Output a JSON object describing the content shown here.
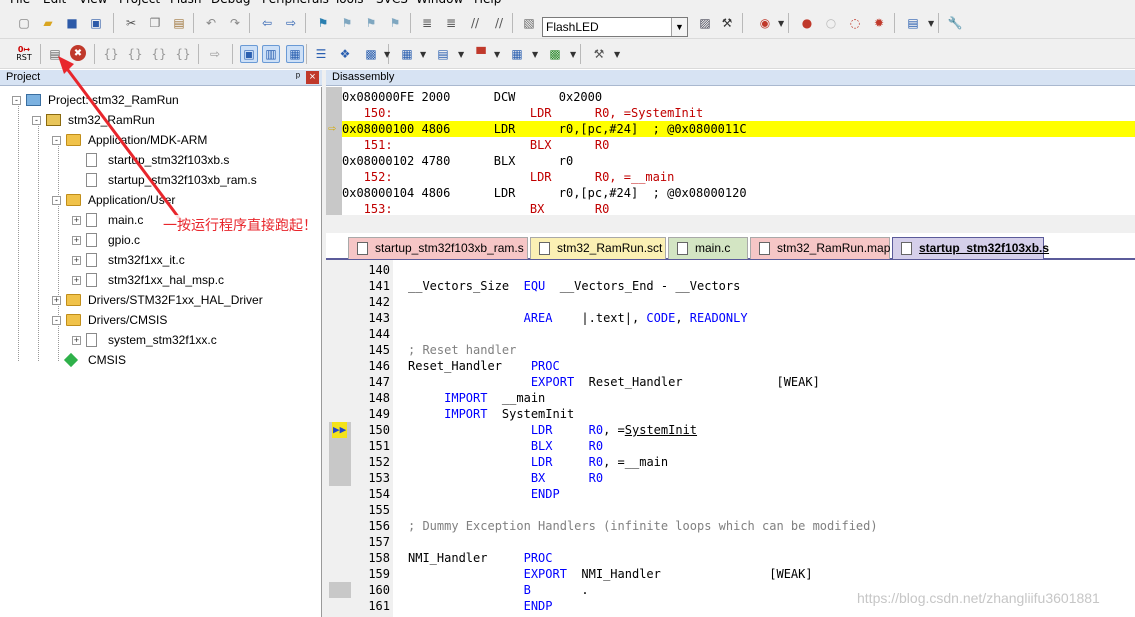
{
  "menu": [
    "File",
    "Edit",
    "View",
    "Project",
    "Flash",
    "Debug",
    "Peripherals",
    "Tools",
    "SVCS",
    "Window",
    "Help"
  ],
  "toolbar": {
    "target_combo": "FlashLED",
    "rst_label": "RST"
  },
  "project_panel": {
    "title": "Project",
    "pin": "ᵖ",
    "close": "×"
  },
  "tree": [
    {
      "label": "Project: stm32_RamRun",
      "level": 0,
      "type": "project",
      "expander": "-"
    },
    {
      "label": "stm32_RamRun",
      "level": 1,
      "type": "target",
      "expander": "-"
    },
    {
      "label": "Application/MDK-ARM",
      "level": 2,
      "type": "folder",
      "expander": "-"
    },
    {
      "label": "startup_stm32f103xb.s",
      "level": 3,
      "type": "file",
      "expander": ""
    },
    {
      "label": "startup_stm32f103xb_ram.s",
      "level": 3,
      "type": "file",
      "expander": ""
    },
    {
      "label": "Application/User",
      "level": 2,
      "type": "folder",
      "expander": "-"
    },
    {
      "label": "main.c",
      "level": 3,
      "type": "file",
      "expander": "+"
    },
    {
      "label": "gpio.c",
      "level": 3,
      "type": "file",
      "expander": "+"
    },
    {
      "label": "stm32f1xx_it.c",
      "level": 3,
      "type": "file",
      "expander": "+"
    },
    {
      "label": "stm32f1xx_hal_msp.c",
      "level": 3,
      "type": "file",
      "expander": "+"
    },
    {
      "label": "Drivers/STM32F1xx_HAL_Driver",
      "level": 2,
      "type": "folder",
      "expander": "+"
    },
    {
      "label": "Drivers/CMSIS",
      "level": 2,
      "type": "folder",
      "expander": "-"
    },
    {
      "label": "system_stm32f1xx.c",
      "level": 3,
      "type": "file",
      "expander": "+"
    },
    {
      "label": "CMSIS",
      "level": 2,
      "type": "component",
      "expander": ""
    }
  ],
  "disassembly": {
    "title": "Disassembly",
    "lines": [
      {
        "text": "0x080000FE 2000      DCW      0x2000",
        "kind": "asm"
      },
      {
        "text": "   150:                   LDR      R0, =SystemInit",
        "kind": "src"
      },
      {
        "text": "0x08000100 4806      LDR      r0,[pc,#24]  ; @0x0800011C",
        "kind": "hl"
      },
      {
        "text": "   151:                   BLX      R0",
        "kind": "src"
      },
      {
        "text": "0x08000102 4780      BLX      r0",
        "kind": "asm"
      },
      {
        "text": "   152:                   LDR      R0, =__main",
        "kind": "src"
      },
      {
        "text": "0x08000104 4806      LDR      r0,[pc,#24]  ; @0x08000120",
        "kind": "asm"
      },
      {
        "text": "   153:                   BX       R0",
        "kind": "src"
      }
    ]
  },
  "tabs": [
    {
      "label": "startup_stm32f103xb_ram.s",
      "color": "#f6c6c6",
      "active": false
    },
    {
      "label": "stm32_RamRun.sct",
      "color": "#fbf0b4",
      "active": false
    },
    {
      "label": "main.c",
      "color": "#d3e5c3",
      "active": false
    },
    {
      "label": "stm32_RamRun.map",
      "color": "#f6c6c6",
      "active": false
    },
    {
      "label": "startup_stm32f103xb.s",
      "color": "#d5cfea",
      "active": true
    }
  ],
  "editor": [
    {
      "n": "140",
      "html": ""
    },
    {
      "n": "141",
      "html": "__Vectors_Size  <span class='kw'>EQU</span>  __Vectors_End - __Vectors"
    },
    {
      "n": "142",
      "html": ""
    },
    {
      "n": "143",
      "html": "                <span class='kw'>AREA</span>    |.text|, <span class='kw'>CODE</span>, <span class='kw'>READONLY</span>"
    },
    {
      "n": "144",
      "html": ""
    },
    {
      "n": "145",
      "html": "<span class='cm'>; Reset handler</span>"
    },
    {
      "n": "146",
      "html": "Reset_Handler    <span class='kw'>PROC</span>"
    },
    {
      "n": "147",
      "html": "                 <span class='kw'>EXPORT</span>  Reset_Handler             [WEAK]"
    },
    {
      "n": "148",
      "html": "     <span class='kw'>IMPORT</span>  __main"
    },
    {
      "n": "149",
      "html": "     <span class='kw'>IMPORT</span>  SystemInit"
    },
    {
      "n": "150",
      "html": "                 <span class='kw'>LDR</span>     <span class='kw'>R0</span>, =<u>SystemInit</u>"
    },
    {
      "n": "151",
      "html": "                 <span class='kw'>BLX</span>     <span class='kw'>R0</span>"
    },
    {
      "n": "152",
      "html": "                 <span class='kw'>LDR</span>     <span class='kw'>R0</span>, =__main"
    },
    {
      "n": "153",
      "html": "                 <span class='kw'>BX</span>      <span class='kw'>R0</span>"
    },
    {
      "n": "154",
      "html": "                 <span class='kw'>ENDP</span>"
    },
    {
      "n": "155",
      "html": ""
    },
    {
      "n": "156",
      "html": "<span class='cm'>; Dummy Exception Handlers (infinite loops which can be modified)</span>"
    },
    {
      "n": "157",
      "html": ""
    },
    {
      "n": "158",
      "html": "NMI_Handler     <span class='kw'>PROC</span>"
    },
    {
      "n": "159",
      "html": "                <span class='kw'>EXPORT</span>  NMI_Handler               [WEAK]"
    },
    {
      "n": "160",
      "html": "                <span class='kw'>B</span>       ."
    },
    {
      "n": "161",
      "html": "                <span class='kw'>ENDP</span>"
    }
  ],
  "annotation": "一按运行程序直接跑起！",
  "watermark": "https://blog.csdn.net/zhangliifu3601881"
}
